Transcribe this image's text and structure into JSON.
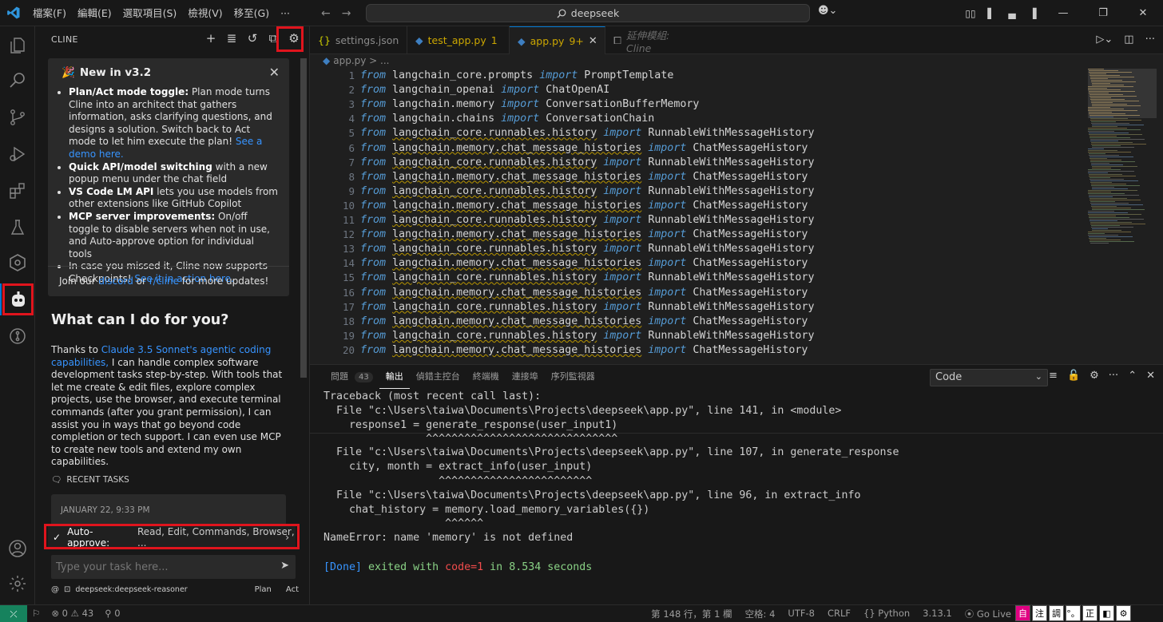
{
  "titlebar": {
    "menus": [
      "檔案(F)",
      "編輯(E)",
      "選取項目(S)",
      "檢視(V)",
      "移至(G)",
      "···"
    ],
    "search": "deepseek"
  },
  "cline": {
    "header": "CLINE",
    "announcement": {
      "title": "New in v3.2",
      "items": [
        {
          "bold": "Plan/Act mode toggle:",
          "text": " Plan mode turns Cline into an architect that gathers information, asks clarifying questions, and designs a solution. Switch back to Act mode to let him execute the plan! ",
          "link": "See a demo here."
        },
        {
          "bold": "Quick API/model switching",
          "text": " with a new popup menu under the chat field",
          "link": ""
        },
        {
          "bold": "VS Code LM API",
          "text": " lets you use models from other extensions like GitHub Copilot",
          "link": ""
        },
        {
          "bold": "MCP server improvements:",
          "text": " On/off toggle to disable servers when not in use, and Auto-approve option for individual tools",
          "link": ""
        },
        {
          "bold": "",
          "text": "In case you missed it, Cline now supports Checkpoints! ",
          "link": "See it in action here."
        }
      ],
      "footer_pre": "Join our ",
      "footer_link1": "discord",
      "footer_mid": " or ",
      "footer_link2": "r/cline",
      "footer_post": " for more updates!"
    },
    "help_title": "What can I do for you?",
    "help_pre": "Thanks to ",
    "help_link": "Claude 3.5 Sonnet's agentic coding capabilities,",
    "help_post": " I can handle complex software development tasks step-by-step. With tools that let me create & edit files, explore complex projects, use the browser, and execute terminal commands (after you grant permission), I can assist you in ways that go beyond code completion or tech support. I can even use MCP to create new tools and extend my own capabilities.",
    "recent_label": "RECENT TASKS",
    "recent_date": "JANUARY 22, 9:33 PM",
    "auto_approve_label": "Auto-approve:",
    "auto_approve_items": "Read, Edit, Commands, Browser, ...",
    "task_placeholder": "Type your task here...",
    "model": "deepseek:deepseek-reasoner",
    "plan": "Plan",
    "act": "Act"
  },
  "tabs": [
    {
      "label": "settings.json",
      "mod": "",
      "active": false
    },
    {
      "label": "test_app.py",
      "mod": "1",
      "active": false
    },
    {
      "label": "app.py",
      "mod": "9+",
      "active": true
    },
    {
      "label": "延伸模組: Cline",
      "mod": "",
      "active": false
    }
  ],
  "breadcrumb": "app.py > ...",
  "code_lines": [
    {
      "n": "1",
      "mod": "langchain_core.prompts",
      "cls": "PromptTemplate",
      "warn": false
    },
    {
      "n": "2",
      "mod": "langchain_openai",
      "cls": "ChatOpenAI",
      "warn": false
    },
    {
      "n": "3",
      "mod": "langchain.memory",
      "cls": "ConversationBufferMemory",
      "warn": false
    },
    {
      "n": "4",
      "mod": "langchain.chains",
      "cls": "ConversationChain",
      "warn": false
    },
    {
      "n": "5",
      "mod": "langchain_core.runnables.history",
      "cls": "RunnableWithMessageHistory",
      "warn": true
    },
    {
      "n": "6",
      "mod": "langchain.memory.chat_message_histories",
      "cls": "ChatMessageHistory",
      "warn": true
    },
    {
      "n": "7",
      "mod": "langchain_core.runnables.history",
      "cls": "RunnableWithMessageHistory",
      "warn": true
    },
    {
      "n": "8",
      "mod": "langchain.memory.chat_message_histories",
      "cls": "ChatMessageHistory",
      "warn": true
    },
    {
      "n": "9",
      "mod": "langchain_core.runnables.history",
      "cls": "RunnableWithMessageHistory",
      "warn": true
    },
    {
      "n": "10",
      "mod": "langchain.memory.chat_message_histories",
      "cls": "ChatMessageHistory",
      "warn": true
    },
    {
      "n": "11",
      "mod": "langchain_core.runnables.history",
      "cls": "RunnableWithMessageHistory",
      "warn": true
    },
    {
      "n": "12",
      "mod": "langchain.memory.chat_message_histories",
      "cls": "ChatMessageHistory",
      "warn": true
    },
    {
      "n": "13",
      "mod": "langchain_core.runnables.history",
      "cls": "RunnableWithMessageHistory",
      "warn": true
    },
    {
      "n": "14",
      "mod": "langchain.memory.chat_message_histories",
      "cls": "ChatMessageHistory",
      "warn": true
    },
    {
      "n": "15",
      "mod": "langchain_core.runnables.history",
      "cls": "RunnableWithMessageHistory",
      "warn": true
    },
    {
      "n": "16",
      "mod": "langchain.memory.chat_message_histories",
      "cls": "ChatMessageHistory",
      "warn": true
    },
    {
      "n": "17",
      "mod": "langchain_core.runnables.history",
      "cls": "RunnableWithMessageHistory",
      "warn": true
    },
    {
      "n": "18",
      "mod": "langchain.memory.chat_message_histories",
      "cls": "ChatMessageHistory",
      "warn": true
    },
    {
      "n": "19",
      "mod": "langchain_core.runnables.history",
      "cls": "RunnableWithMessageHistory",
      "warn": true
    },
    {
      "n": "20",
      "mod": "langchain.memory.chat_message_histories",
      "cls": "ChatMessageHistory",
      "warn": true
    }
  ],
  "keywords": {
    "from": "from",
    "import": "import"
  },
  "panel": {
    "tabs": [
      {
        "label": "問題",
        "count": "43"
      },
      {
        "label": "輸出",
        "count": ""
      },
      {
        "label": "偵錯主控台",
        "count": ""
      },
      {
        "label": "終端機",
        "count": ""
      },
      {
        "label": "連接埠",
        "count": ""
      },
      {
        "label": "序列監視器",
        "count": ""
      }
    ],
    "select_value": "Code",
    "output_lines": [
      "Traceback (most recent call last):",
      "  File \"c:\\Users\\taiwa\\Documents\\Projects\\deepseek\\app.py\", line 141, in <module>",
      "    response1 = generate_response(user_input1)",
      "                ^^^^^^^^^^^^^^^^^^^^^^^^^^^^^^",
      "  File \"c:\\Users\\taiwa\\Documents\\Projects\\deepseek\\app.py\", line 107, in generate_response",
      "    city, month = extract_info(user_input)",
      "                  ^^^^^^^^^^^^^^^^^^^^^^^^",
      "  File \"c:\\Users\\taiwa\\Documents\\Projects\\deepseek\\app.py\", line 96, in extract_info",
      "    chat_history = memory.load_memory_variables({})",
      "                   ^^^^^^",
      "NameError: name 'memory' is not defined"
    ],
    "done": "[Done]",
    "exited": " exited with ",
    "code": "code=1",
    "in_time": " in ",
    "seconds": "8.534",
    "seconds_label": " seconds"
  },
  "status": {
    "errors": "0",
    "warnings": "43",
    "ports": "0",
    "position": "第 148 行，第 1 欄",
    "spaces": "空格: 4",
    "encoding": "UTF-8",
    "eol": "CRLF",
    "lang_brace": "{}",
    "language": "Python",
    "version": "3.13.1",
    "golive": "Go Live",
    "ime": [
      "自",
      "注",
      "調",
      "°。",
      "正",
      "◧",
      "⚙"
    ]
  },
  "colors": {
    "accent": "#0078d4",
    "highlight_box": "#e0141d",
    "link": "#3794ff"
  }
}
